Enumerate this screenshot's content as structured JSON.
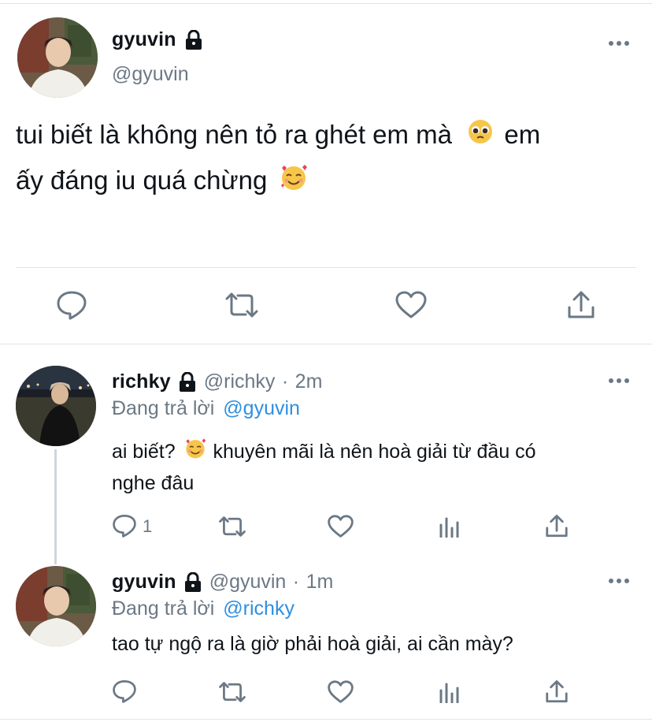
{
  "main_tweet": {
    "name": "gyuvin",
    "handle": "@gyuvin",
    "text_part1": "tui biết là không nên tỏ ra ghét em mà",
    "text_part2": " em",
    "text_part3": "ấy đáng iu quá chừng",
    "emoji1": "pleading-face-emoji",
    "emoji2": "smiling-face-with-hearts-emoji"
  },
  "reply1": {
    "name": "richky",
    "handle": "@richky",
    "dot": "·",
    "time": "2m",
    "replying_prefix": "Đang trả lời",
    "replying_to": "@gyuvin",
    "text_part1": "ai biết?",
    "text_part2": " khuyên mãi là nên hoà giải từ đầu có",
    "text_part3": "nghe đâu",
    "reply_count": "1"
  },
  "reply2": {
    "name": "gyuvin",
    "handle": "@gyuvin",
    "dot": "·",
    "time": "1m",
    "replying_prefix": "Đang trả lời",
    "replying_to": "@richky",
    "text": "tao tự ngộ ra là giờ phải hoà giải, ai cần mày?"
  },
  "colors": {
    "link": "#2f8fe0",
    "muted": "#6b7885",
    "text": "#0f1419",
    "separator": "#e1e4e6"
  }
}
